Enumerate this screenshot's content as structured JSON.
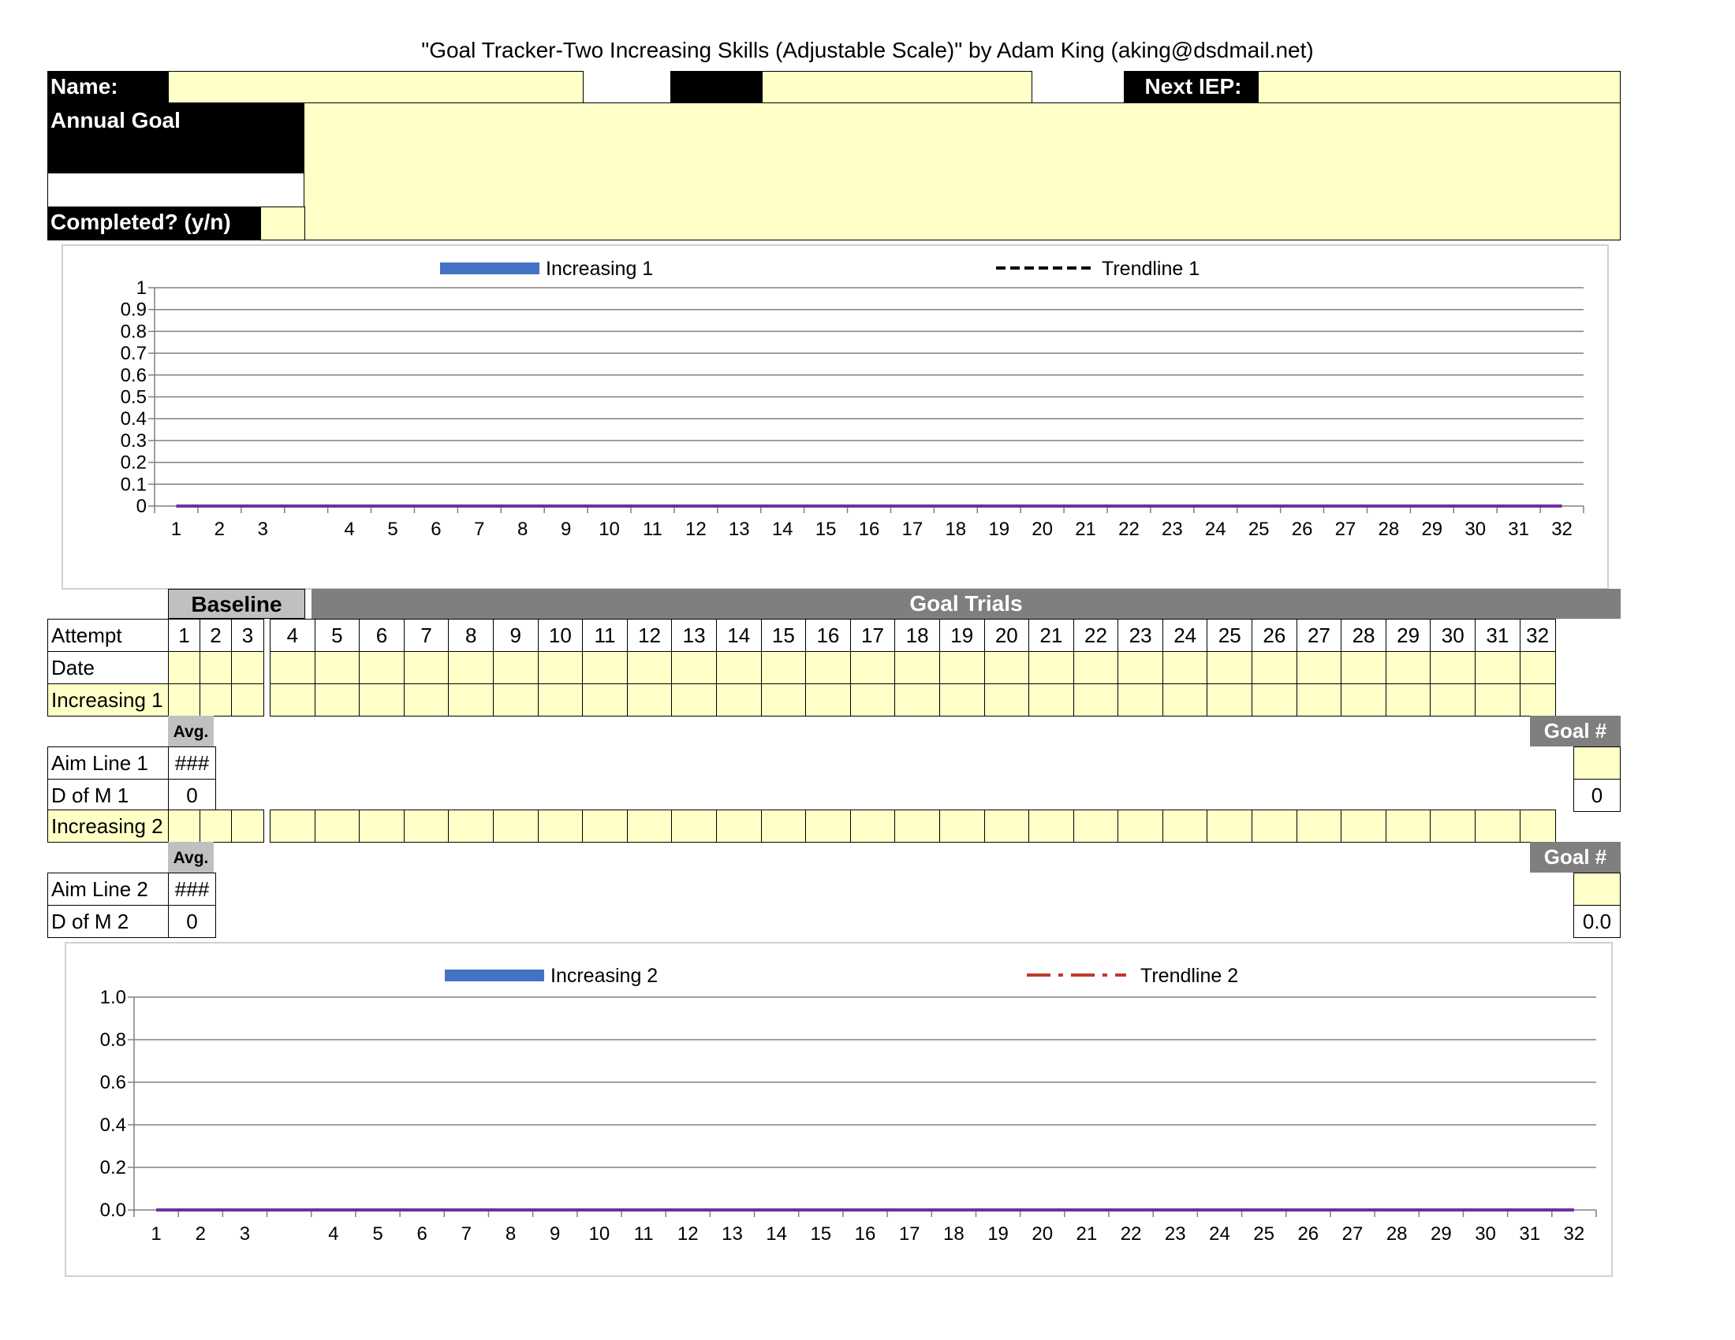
{
  "title": "\"Goal Tracker-Two Increasing Skills (Adjustable Scale)\" by Adam King (aking@dsdmail.net)",
  "header": {
    "name_label": "Name:",
    "name_value": "",
    "blank_label": "",
    "blank_value": "",
    "next_iep_label": "Next IEP:",
    "next_iep_value": "",
    "annual_goal_label": "Annual Goal",
    "annual_goal_value": "",
    "completed_label": "Completed? (y/n)",
    "completed_value": ""
  },
  "table": {
    "baseline_label": "Baseline",
    "goal_trials_label": "Goal Trials",
    "attempt_label": "Attempt",
    "date_label": "Date",
    "increasing1_label": "Increasing 1",
    "increasing2_label": "Increasing 2",
    "avg_label": "Avg.",
    "goal_num_label": "Goal #",
    "aim_line1_label": "Aim Line 1",
    "aim_line1_value": "###",
    "dofm1_label": "D of M 1",
    "dofm1_value": "0",
    "dofm1_goal_value": "0",
    "aim_line2_label": "Aim Line 2",
    "aim_line2_value": "###",
    "dofm2_label": "D of M 2",
    "dofm2_value": "0",
    "dofm2_goal_value": "0.0",
    "attempts": [
      "1",
      "2",
      "3",
      "4",
      "5",
      "6",
      "7",
      "8",
      "9",
      "10",
      "11",
      "12",
      "13",
      "14",
      "15",
      "16",
      "17",
      "18",
      "19",
      "20",
      "21",
      "22",
      "23",
      "24",
      "25",
      "26",
      "27",
      "28",
      "29",
      "30",
      "31",
      "32"
    ]
  },
  "chart_data": [
    {
      "type": "line",
      "title": "",
      "xlabel": "",
      "ylabel": "",
      "categories": [
        "1",
        "2",
        "3",
        "",
        "4",
        "5",
        "6",
        "7",
        "8",
        "9",
        "10",
        "11",
        "12",
        "13",
        "14",
        "15",
        "16",
        "17",
        "18",
        "19",
        "20",
        "21",
        "22",
        "23",
        "24",
        "25",
        "26",
        "27",
        "28",
        "29",
        "30",
        "31",
        "32"
      ],
      "yticks": [
        "0",
        "0.1",
        "0.2",
        "0.3",
        "0.4",
        "0.5",
        "0.6",
        "0.7",
        "0.8",
        "0.9",
        "1"
      ],
      "ylim": [
        0,
        1
      ],
      "grid": true,
      "legend_position": "top",
      "series": [
        {
          "name": "Increasing 1",
          "color": "#4472c4",
          "style": "bar-legend",
          "values": []
        },
        {
          "name": "Trendline 1",
          "color": "#000000",
          "style": "dashed",
          "values": []
        },
        {
          "name": "",
          "color": "#7030a0",
          "style": "solid",
          "values": [
            0,
            0,
            0,
            0,
            0,
            0,
            0,
            0,
            0,
            0,
            0,
            0,
            0,
            0,
            0,
            0,
            0,
            0,
            0,
            0,
            0,
            0,
            0,
            0,
            0,
            0,
            0,
            0,
            0,
            0,
            0,
            0,
            0
          ]
        }
      ]
    },
    {
      "type": "line",
      "title": "",
      "xlabel": "",
      "ylabel": "",
      "categories": [
        "1",
        "2",
        "3",
        "",
        "4",
        "5",
        "6",
        "7",
        "8",
        "9",
        "10",
        "11",
        "12",
        "13",
        "14",
        "15",
        "16",
        "17",
        "18",
        "19",
        "20",
        "21",
        "22",
        "23",
        "24",
        "25",
        "26",
        "27",
        "28",
        "29",
        "30",
        "31",
        "32"
      ],
      "yticks": [
        "0.0",
        "0.2",
        "0.4",
        "0.6",
        "0.8",
        "1.0"
      ],
      "ylim": [
        0,
        1
      ],
      "grid": true,
      "legend_position": "top",
      "series": [
        {
          "name": "Increasing 2",
          "color": "#4472c4",
          "style": "bar-legend",
          "values": []
        },
        {
          "name": "Trendline 2",
          "color": "#c0392b",
          "style": "dash-dot",
          "values": []
        },
        {
          "name": "",
          "color": "#7030a0",
          "style": "solid",
          "values": [
            0,
            0,
            0,
            0,
            0,
            0,
            0,
            0,
            0,
            0,
            0,
            0,
            0,
            0,
            0,
            0,
            0,
            0,
            0,
            0,
            0,
            0,
            0,
            0,
            0,
            0,
            0,
            0,
            0,
            0,
            0,
            0,
            0
          ]
        }
      ]
    }
  ]
}
